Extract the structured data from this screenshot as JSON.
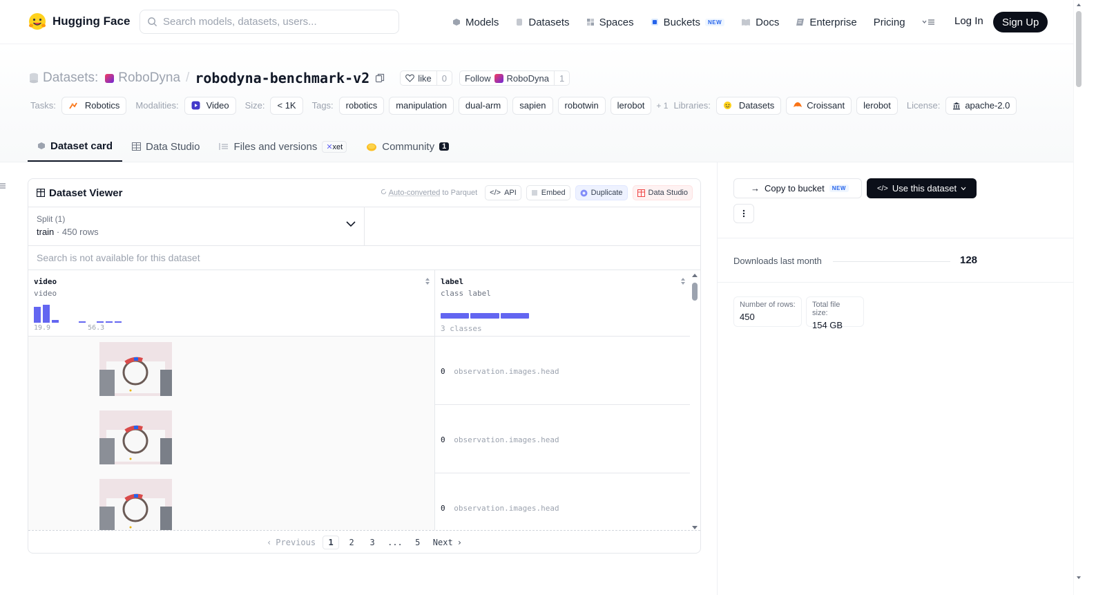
{
  "nav": {
    "brand": "Hugging Face",
    "search_placeholder": "Search models, datasets, users...",
    "links": [
      {
        "label": "Models",
        "icon": "models-icon"
      },
      {
        "label": "Datasets",
        "icon": "datasets-icon"
      },
      {
        "label": "Spaces",
        "icon": "spaces-icon"
      },
      {
        "label": "Buckets",
        "icon": "buckets-icon",
        "badge": "NEW"
      },
      {
        "label": "Docs",
        "icon": "docs-icon"
      },
      {
        "label": "Enterprise",
        "icon": "enterprise-icon"
      },
      {
        "label": "Pricing"
      }
    ],
    "login": "Log In",
    "signup": "Sign Up"
  },
  "header": {
    "kind": "Datasets:",
    "owner": "RoboDyna",
    "name": "robodyna-benchmark-v2",
    "like_label": "like",
    "like_count": "0",
    "follow_label": "Follow",
    "follow_name": "RoboDyna",
    "follow_count": "1"
  },
  "meta": {
    "tasks_label": "Tasks:",
    "tasks": [
      "Robotics"
    ],
    "modalities_label": "Modalities:",
    "modalities": [
      "Video"
    ],
    "size_label": "Size:",
    "size": "< 1K",
    "tags_label": "Tags:",
    "tags": [
      "robotics",
      "manipulation",
      "dual-arm",
      "sapien",
      "robotwin",
      "lerobot"
    ],
    "tags_more": "+ 1",
    "libraries_label": "Libraries:",
    "libraries": [
      "Datasets",
      "Croissant",
      "lerobot"
    ],
    "license_label": "License:",
    "license": "apache-2.0"
  },
  "tabs": [
    {
      "label": "Dataset card",
      "active": true
    },
    {
      "label": "Data Studio"
    },
    {
      "label": "Files and versions",
      "badge": "xet"
    },
    {
      "label": "Community",
      "count": "1"
    }
  ],
  "viewer": {
    "title": "Dataset Viewer",
    "auto_converted": "Auto-converted",
    "to_parquet": " to Parquet",
    "actions": [
      "API",
      "Embed",
      "Duplicate",
      "Data Studio"
    ],
    "split_label": "Split (1)",
    "split_value": "train",
    "split_rows": "450 rows",
    "search_na": "Search is not available for this dataset",
    "columns": [
      {
        "name": "video",
        "type": "video",
        "hist_min": "19.9",
        "hist_max": "56.3",
        "hist_values": [
          0.9,
          1.0,
          0.15,
          0,
          0,
          0.05,
          0,
          0.05,
          0.05,
          0.05
        ]
      },
      {
        "name": "label",
        "type": "class label",
        "classes_text": "3 classes",
        "class_shares": [
          0.33,
          0.34,
          0.33
        ]
      }
    ],
    "rows": [
      {
        "label_id": "0",
        "label_name": "observation.images.head"
      },
      {
        "label_id": "0",
        "label_name": "observation.images.head"
      },
      {
        "label_id": "0",
        "label_name": "observation.images.head"
      }
    ],
    "pager": {
      "prev": "Previous",
      "pages": [
        "1",
        "2",
        "3",
        "...",
        "5"
      ],
      "current": "1",
      "next": "Next"
    }
  },
  "sidebar": {
    "copy_bucket": "Copy to bucket",
    "copy_badge": "NEW",
    "use_dataset": "Use this dataset",
    "downloads_label": "Downloads last month",
    "downloads_value": "128",
    "rows_label": "Number of rows:",
    "rows_value": "450",
    "size_label": "Total file size:",
    "size_value": "154 GB"
  },
  "colors": {
    "accent": "#6366f1",
    "dark": "#0b0f19"
  }
}
